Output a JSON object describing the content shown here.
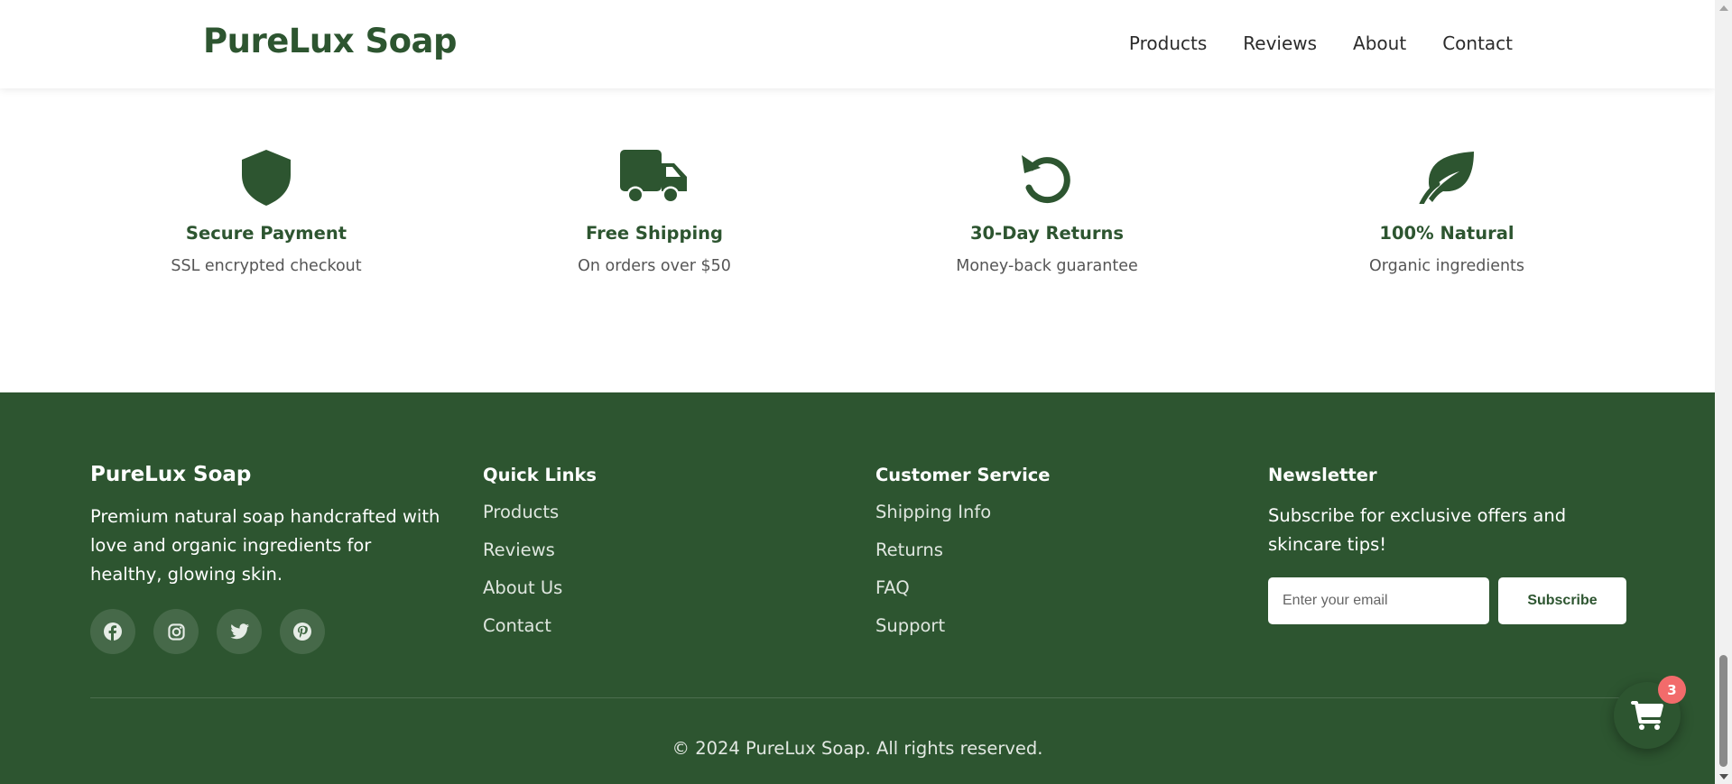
{
  "header": {
    "logo": "PureLux Soap",
    "nav": [
      "Products",
      "Reviews",
      "About",
      "Contact"
    ]
  },
  "features": [
    {
      "icon": "shield-icon",
      "title": "Secure Payment",
      "desc": "SSL encrypted checkout"
    },
    {
      "icon": "truck-icon",
      "title": "Free Shipping",
      "desc": "On orders over $50"
    },
    {
      "icon": "undo-icon",
      "title": "30-Day Returns",
      "desc": "Money-back guarantee"
    },
    {
      "icon": "leaf-icon",
      "title": "100% Natural",
      "desc": "Organic ingredients"
    }
  ],
  "footer": {
    "brand": {
      "name": "PureLux Soap",
      "description": "Premium natural soap handcrafted with love and organic ingredients for healthy, glowing skin.",
      "socials": [
        "facebook-icon",
        "instagram-icon",
        "twitter-icon",
        "pinterest-icon"
      ]
    },
    "quick_links": {
      "title": "Quick Links",
      "items": [
        "Products",
        "Reviews",
        "About Us",
        "Contact"
      ]
    },
    "customer_service": {
      "title": "Customer Service",
      "items": [
        "Shipping Info",
        "Returns",
        "FAQ",
        "Support"
      ]
    },
    "newsletter": {
      "title": "Newsletter",
      "description": "Subscribe for exclusive offers and skincare tips!",
      "placeholder": "Enter your email",
      "button": "Subscribe"
    },
    "copyright": "© 2024 PureLux Soap. All rights reserved."
  },
  "cart": {
    "icon": "shopping-cart-icon",
    "count": "3"
  },
  "colors": {
    "brand": "#2d5530",
    "badge": "#f26b6b",
    "background": "#ffffff"
  }
}
